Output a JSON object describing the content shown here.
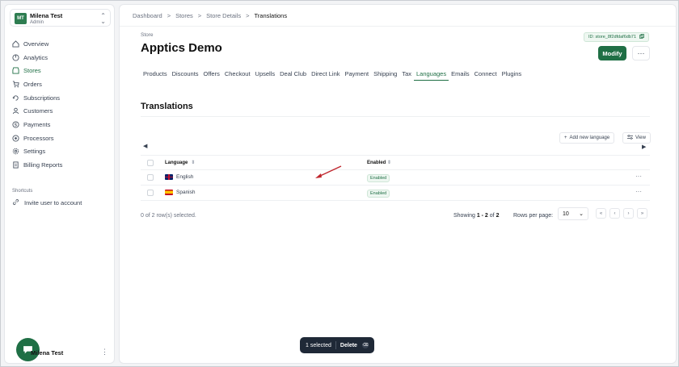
{
  "sidebar": {
    "org": {
      "initials": "MT",
      "name": "Milena Test",
      "role": "Admin"
    },
    "items": [
      {
        "label": "Overview",
        "icon": "home-icon"
      },
      {
        "label": "Analytics",
        "icon": "analytics-icon"
      },
      {
        "label": "Stores",
        "icon": "store-icon",
        "active": true
      },
      {
        "label": "Orders",
        "icon": "cart-icon"
      },
      {
        "label": "Subscriptions",
        "icon": "subscriptions-icon"
      },
      {
        "label": "Customers",
        "icon": "user-icon"
      },
      {
        "label": "Payments",
        "icon": "dollar-icon"
      },
      {
        "label": "Processors",
        "icon": "processor-icon"
      },
      {
        "label": "Settings",
        "icon": "gear-icon"
      },
      {
        "label": "Billing Reports",
        "icon": "report-icon"
      }
    ],
    "shortcuts_title": "Shortcuts",
    "shortcut_label": "Invite user to account",
    "user_name": "Milena Test"
  },
  "breadcrumb": {
    "items": [
      "Dashboard",
      "Stores",
      "Store Details"
    ],
    "current": "Translations",
    "sep": ">"
  },
  "header": {
    "kicker": "Store",
    "title": "Apptics Demo",
    "store_id": "ID: store_8f2dfdaf6db71",
    "modify_label": "Modify",
    "more_label": "···"
  },
  "tabs": [
    "Products",
    "Discounts",
    "Offers",
    "Checkout",
    "Upsells",
    "Deal Club",
    "Direct Link",
    "Payment",
    "Shipping",
    "Tax",
    "Languages",
    "Emails",
    "Connect",
    "Plugins"
  ],
  "active_tab": "Languages",
  "section_title": "Translations",
  "toolbar": {
    "add_label": "Add new language",
    "view_label": "View"
  },
  "table": {
    "headers": {
      "language": "Language",
      "enabled": "Enabled"
    },
    "rows": [
      {
        "language": "English",
        "status": "Enabled",
        "flag": "uk"
      },
      {
        "language": "Spanish",
        "status": "Enabled",
        "flag": "es"
      }
    ]
  },
  "footer": {
    "selected_text": "0 of 2 row(s) selected.",
    "showing_prefix": "Showing",
    "showing_range": "1 - 2",
    "showing_of": "of",
    "showing_total": "2",
    "rows_per_page_label": "Rows per page:",
    "rows_per_page": "10"
  },
  "selection_bar": {
    "count_label": "1 selected",
    "delete_label": "Delete",
    "shortcut": "⌫"
  },
  "colors": {
    "accent": "#1f6f45",
    "annotation_arrow": "#c0262d"
  }
}
